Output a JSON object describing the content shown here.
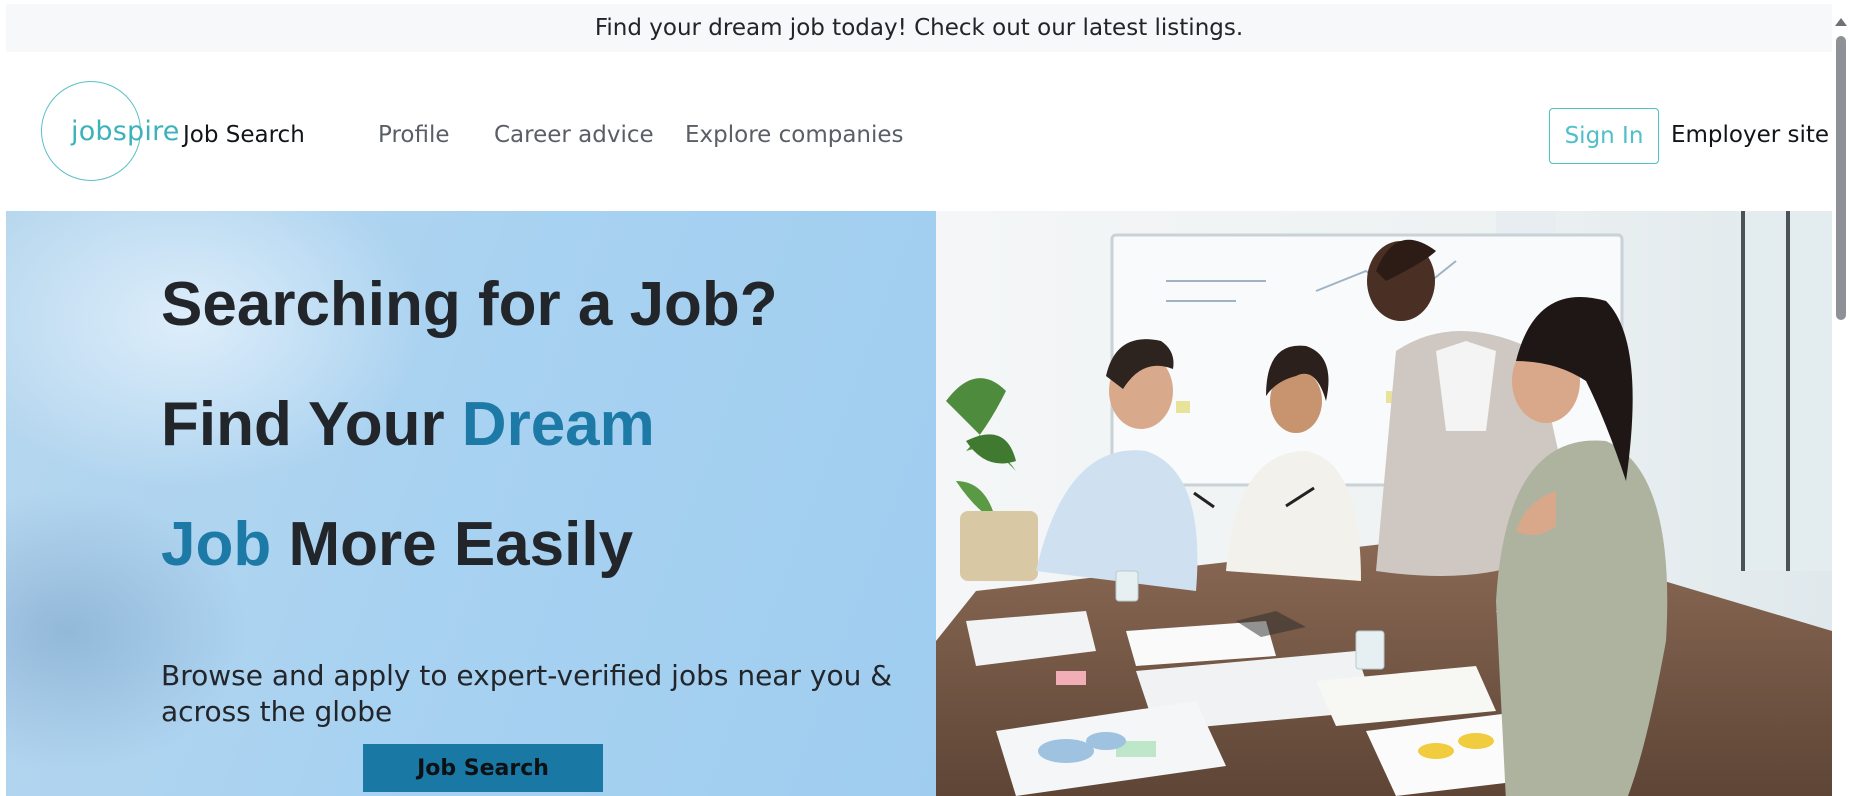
{
  "announcement": "Find your dream job today! Check out our latest listings.",
  "brand": {
    "logo_text": "jobspire"
  },
  "nav": {
    "items": [
      {
        "label": "Job Search",
        "active": true
      },
      {
        "label": "Profile",
        "active": false
      },
      {
        "label": "Career advice",
        "active": false
      },
      {
        "label": "Explore companies",
        "active": false
      }
    ],
    "sign_in": "Sign In",
    "employer": "Employer site"
  },
  "hero": {
    "line1": "Searching for a Job?",
    "line2_prefix": "Find Your ",
    "line2_accent": "Dream",
    "line3_accent": "Job",
    "line3_suffix": " More Easily",
    "subtitle": "Browse and apply to expert-verified jobs near you & across the globe",
    "cta": "Job Search"
  },
  "colors": {
    "accent": "#1d7aa6",
    "brand_teal": "#3cb3bb",
    "cta_bg": "#1a78a4",
    "text_dark": "#22262b"
  }
}
